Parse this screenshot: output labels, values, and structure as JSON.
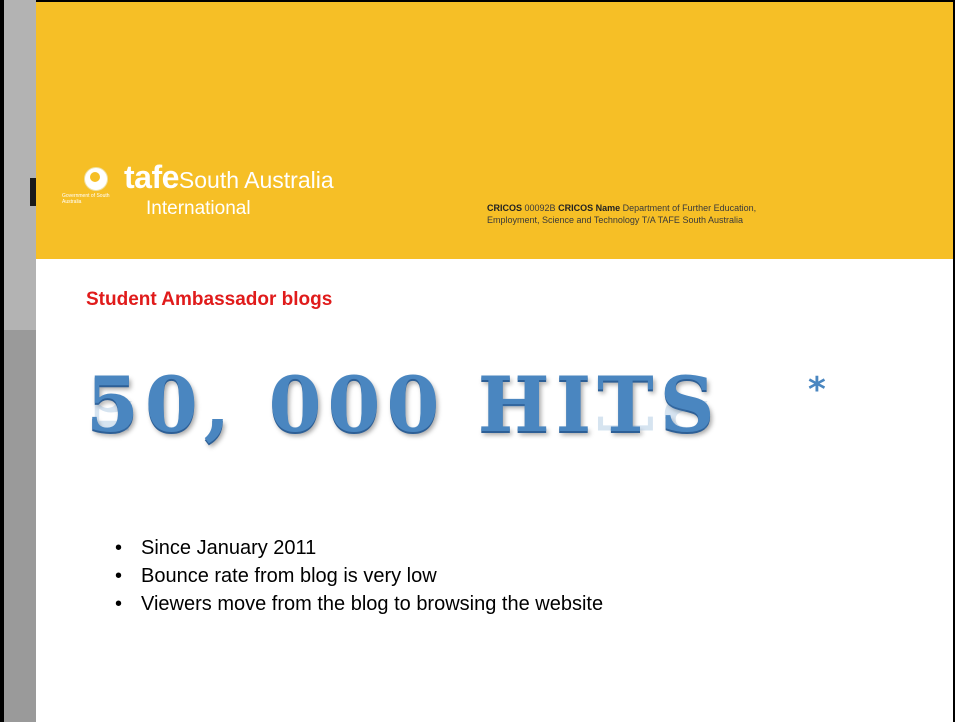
{
  "header": {
    "brand_bold": "tafe",
    "brand_rest": "South Australia",
    "brand_sub": "International",
    "crest_text": "Government of South Australia",
    "cricos_label1": "CRICOS",
    "cricos_code": "00092B",
    "cricos_label2": "CRICOS Name",
    "cricos_name_line1": "Department of Further Education,",
    "cricos_name_line2": "Employment, Science and Technology T/A TAFE South Australia",
    "background": "#f6bf26"
  },
  "slide": {
    "title": "Student Ambassador blogs",
    "title_color": "#e01b1b",
    "hits_text": "50, 000 HITS",
    "hits_mark": "*",
    "hits_color": "#4a86c0",
    "bullets": [
      "Since January 2011",
      "Bounce rate from blog is very low",
      "Viewers move from the blog to browsing the website"
    ]
  }
}
